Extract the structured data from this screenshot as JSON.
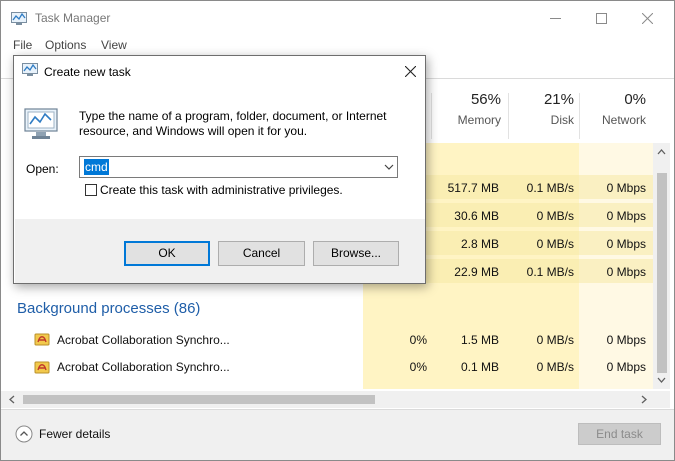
{
  "window": {
    "title": "Task Manager"
  },
  "menu": [
    "File",
    "Options",
    "View"
  ],
  "columns": [
    {
      "pct": "56%",
      "label": "Memory"
    },
    {
      "pct": "21%",
      "label": "Disk"
    },
    {
      "pct": "0%",
      "label": "Network"
    }
  ],
  "top_rows": [
    {
      "memory": "517.7 MB",
      "disk": "0.1 MB/s",
      "network": "0 Mbps"
    },
    {
      "memory": "30.6 MB",
      "disk": "0 MB/s",
      "network": "0 Mbps"
    },
    {
      "memory": "2.8 MB",
      "disk": "0 MB/s",
      "network": "0 Mbps"
    },
    {
      "memory": "22.9 MB",
      "disk": "0.1 MB/s",
      "network": "0 Mbps"
    }
  ],
  "background": {
    "title": "Background processes (86)",
    "rows": [
      {
        "name": "Acrobat Collaboration Synchro...",
        "cpu": "0%",
        "memory": "1.5 MB",
        "disk": "0 MB/s",
        "network": "0 Mbps",
        "icon": "acrobat-icon"
      },
      {
        "name": "Acrobat Collaboration Synchro...",
        "cpu": "0%",
        "memory": "0.1 MB",
        "disk": "0 MB/s",
        "network": "0 Mbps",
        "icon": "acrobat-icon"
      }
    ]
  },
  "footer": {
    "fewer_details": "Fewer details",
    "end_task": "End task"
  },
  "dialog": {
    "title": "Create new task",
    "description": "Type the name of a program, folder, document, or Internet resource, and Windows will open it for you.",
    "open_label": "Open:",
    "open_value": "cmd",
    "admin_checkbox_label": "Create this task with administrative privileges.",
    "admin_checked": false,
    "ok": "OK",
    "cancel": "Cancel",
    "browse": "Browse..."
  },
  "colors": {
    "accent": "#0078d7",
    "section_title": "#1f5ea8",
    "heat_yellow": "#fff4c4"
  }
}
